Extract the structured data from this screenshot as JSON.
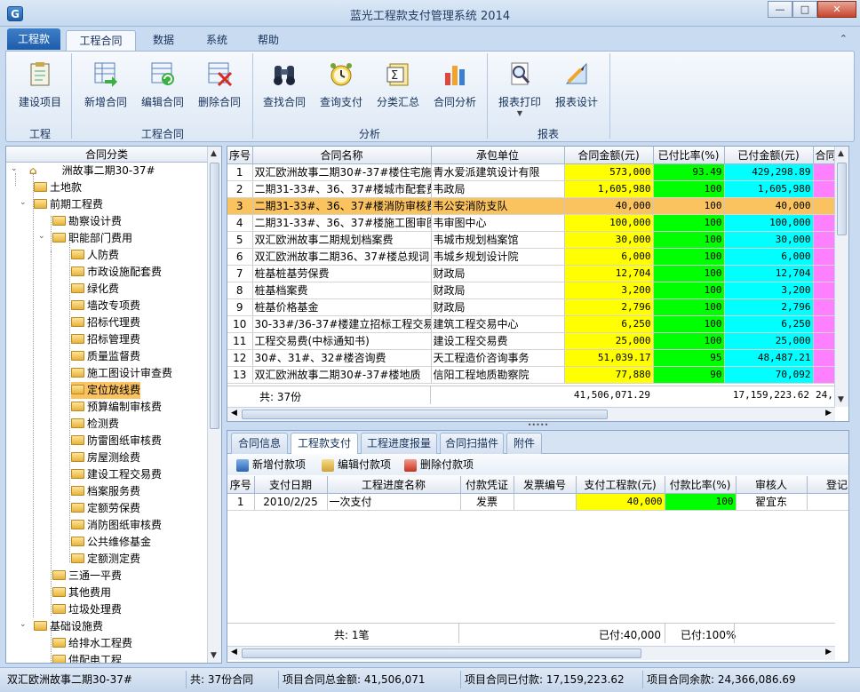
{
  "window": {
    "title": "蓝光工程款支付管理系统 2014",
    "min": "—",
    "max": "□",
    "close": "✕"
  },
  "ribbon_tabs": {
    "app": "工程款",
    "tabs": [
      "工程合同",
      "数据",
      "系统",
      "帮助"
    ]
  },
  "ribbon": {
    "buttons": [
      {
        "label": "建设项目",
        "icon": "clipboard-icon"
      },
      {
        "label": "新增合同",
        "icon": "add-document-icon"
      },
      {
        "label": "编辑合同",
        "icon": "edit-document-icon"
      },
      {
        "label": "删除合同",
        "icon": "delete-document-icon"
      },
      {
        "label": "查找合同",
        "icon": "binoculars-icon"
      },
      {
        "label": "查询支付",
        "icon": "alarm-clock-icon"
      },
      {
        "label": "分类汇总",
        "icon": "sigma-document-icon"
      },
      {
        "label": "合同分析",
        "icon": "bar-chart-icon"
      },
      {
        "label": "报表打印",
        "icon": "magnifier-print-icon"
      },
      {
        "label": "报表设计",
        "icon": "design-tools-icon"
      }
    ],
    "groups": [
      "工程",
      "工程合同",
      "分析",
      "报表"
    ]
  },
  "tree": {
    "header": "合同分类",
    "items": [
      "洲故事二期30-37#",
      "土地款",
      "前期工程费",
      "勘察设计费",
      "职能部门费用",
      "人防费",
      "市政设施配套费",
      "绿化费",
      "墙改专项费",
      "招标代理费",
      "招标管理费",
      "质量监督费",
      "施工图设计审查费",
      "定位放线费",
      "预算编制审核费",
      "检测费",
      "防雷图纸审核费",
      "房屋测绘费",
      "建设工程交易费",
      "档案服务费",
      "定额劳保费",
      "消防图纸审核费",
      "公共维修基金",
      "定额测定费",
      "三通一平费",
      "其他费用",
      "垃圾处理费",
      "基础设施费",
      "给排水工程费",
      "供配电工程"
    ]
  },
  "contracts": {
    "headers": [
      "序号",
      "合同名称",
      "承包单位",
      "合同金额(元)",
      "已付比率(%)",
      "已付金额(元)",
      "合同"
    ],
    "rows": [
      [
        "1",
        "双汇欧洲故事二期30#-37#楼住宅施",
        "青水爱派建筑设计有限",
        "573,000",
        "93.49",
        "429,298.89"
      ],
      [
        "2",
        "二期31-33#、36、37#楼城市配套费",
        "韦政局",
        "1,605,980",
        "100",
        "1,605,980"
      ],
      [
        "3",
        "二期31-33#、36、37#楼消防审核费",
        "韦公安消防支队",
        "40,000",
        "100",
        "40,000"
      ],
      [
        "4",
        "二期31-33#、36、37#楼施工图审图",
        "韦审图中心",
        "100,000",
        "100",
        "100,000"
      ],
      [
        "5",
        "双汇欧洲故事二期规划档案费",
        "韦城市规划档案馆",
        "30,000",
        "100",
        "30,000"
      ],
      [
        "6",
        "双汇欧洲故事二期36、37#楼总规词",
        "韦城乡规划设计院",
        "6,000",
        "100",
        "6,000"
      ],
      [
        "7",
        "桩基桩基劳保费",
        "财政局",
        "12,704",
        "100",
        "12,704"
      ],
      [
        "8",
        "桩基档案费",
        "财政局",
        "3,200",
        "100",
        "3,200"
      ],
      [
        "9",
        "桩基价格基金",
        "财政局",
        "2,796",
        "100",
        "2,796"
      ],
      [
        "10",
        "30-33#/36-37#楼建立招标工程交易",
        "建筑工程交易中心",
        "6,250",
        "100",
        "6,250"
      ],
      [
        "11",
        "工程交易费(中标通知书)",
        "建设工程交易费",
        "25,000",
        "100",
        "25,000"
      ],
      [
        "12",
        "30#、31#、32#楼咨询费",
        "天工程造价咨询事务",
        "51,039.17",
        "95",
        "48,487.21"
      ],
      [
        "13",
        "双汇欧洲故事二期30#-37#楼地质",
        "信阳工程地质勘察院",
        "77,880",
        "90",
        "70,092"
      ]
    ],
    "summary": {
      "count": "共: 37份",
      "total": "41,506,071.29",
      "paid": "17,159,223.62",
      "extra": "24,"
    }
  },
  "detail_tabs": [
    "合同信息",
    "工程款支付",
    "工程进度报量",
    "合同扫描件",
    "附件"
  ],
  "payment_toolbar": [
    "新增付款项",
    "编辑付款项",
    "删除付款项"
  ],
  "payments": {
    "headers": [
      "序号",
      "支付日期",
      "工程进度名称",
      "付款凭证",
      "发票编号",
      "支付工程款(元)",
      "付款比率(%)",
      "审核人",
      "登记"
    ],
    "rows": [
      [
        "1",
        "2010/2/25",
        "一次支付",
        "发票",
        "",
        "40,000",
        "100",
        "翟宜东",
        ""
      ]
    ],
    "summary": {
      "count": "共: 1笔",
      "paid": "已付:40,000",
      "ratio": "已付:100%"
    }
  },
  "status": {
    "project": "双汇欧洲故事二期30-37#",
    "count": "共: 37份合同",
    "total": "项目合同总金额: 41,506,071",
    "paid": "项目合同已付款: 17,159,223.62",
    "remain": "项目合同余款: 24,366,086.69"
  }
}
